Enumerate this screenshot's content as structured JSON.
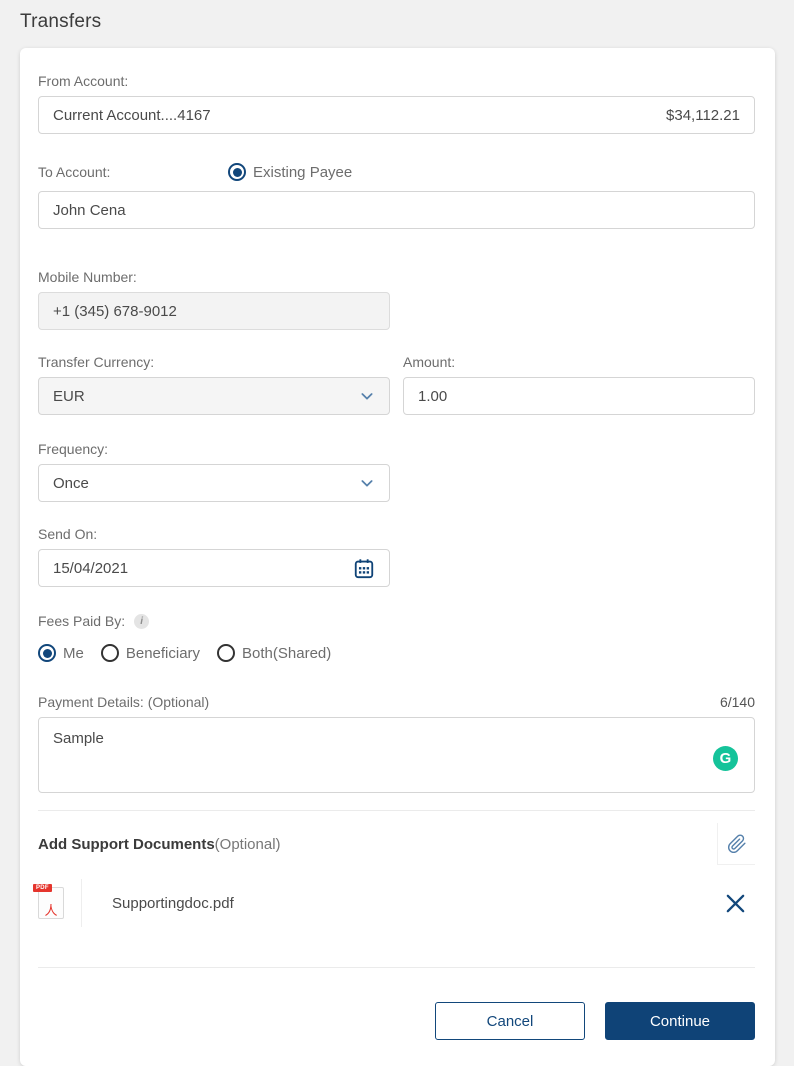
{
  "page": {
    "title": "Transfers"
  },
  "colors": {
    "accent_navy": "#12477b",
    "button_primary": "#0f4377",
    "grammarly_green": "#15c39a",
    "pdf_red": "#e5352d",
    "label_gray": "#6d6d6d",
    "page_background": "#f1f1f1"
  },
  "form": {
    "from_account": {
      "label": "From Account:",
      "value": "Current Account....4167",
      "balance": "$34,112.21"
    },
    "to_account": {
      "label": "To Account:",
      "radio_label": "Existing Payee",
      "value": "John Cena"
    },
    "mobile_number": {
      "label": "Mobile Number:",
      "value": "+1 (345) 678-9012"
    },
    "transfer_currency": {
      "label": "Transfer Currency:",
      "value": "EUR"
    },
    "amount": {
      "label": "Amount:",
      "value": "1.00"
    },
    "frequency": {
      "label": "Frequency:",
      "value": "Once"
    },
    "send_on": {
      "label": "Send On:",
      "value": "15/04/2021"
    },
    "fees_paid_by": {
      "label": "Fees Paid By:",
      "info_icon": "i",
      "options": [
        {
          "label": "Me",
          "selected": true
        },
        {
          "label": "Beneficiary",
          "selected": false
        },
        {
          "label": "Both(Shared)",
          "selected": false
        }
      ]
    },
    "payment_details": {
      "label": "Payment Details: (Optional)",
      "counter": "6/140",
      "value": "Sample",
      "grammarly_letter": "G"
    },
    "support_documents": {
      "label_bold": "Add Support Documents",
      "label_optional": "(Optional)",
      "file_name": "Supportingdoc.pdf",
      "file_badge": "PDF"
    },
    "actions": {
      "cancel": "Cancel",
      "continue": "Continue"
    }
  }
}
